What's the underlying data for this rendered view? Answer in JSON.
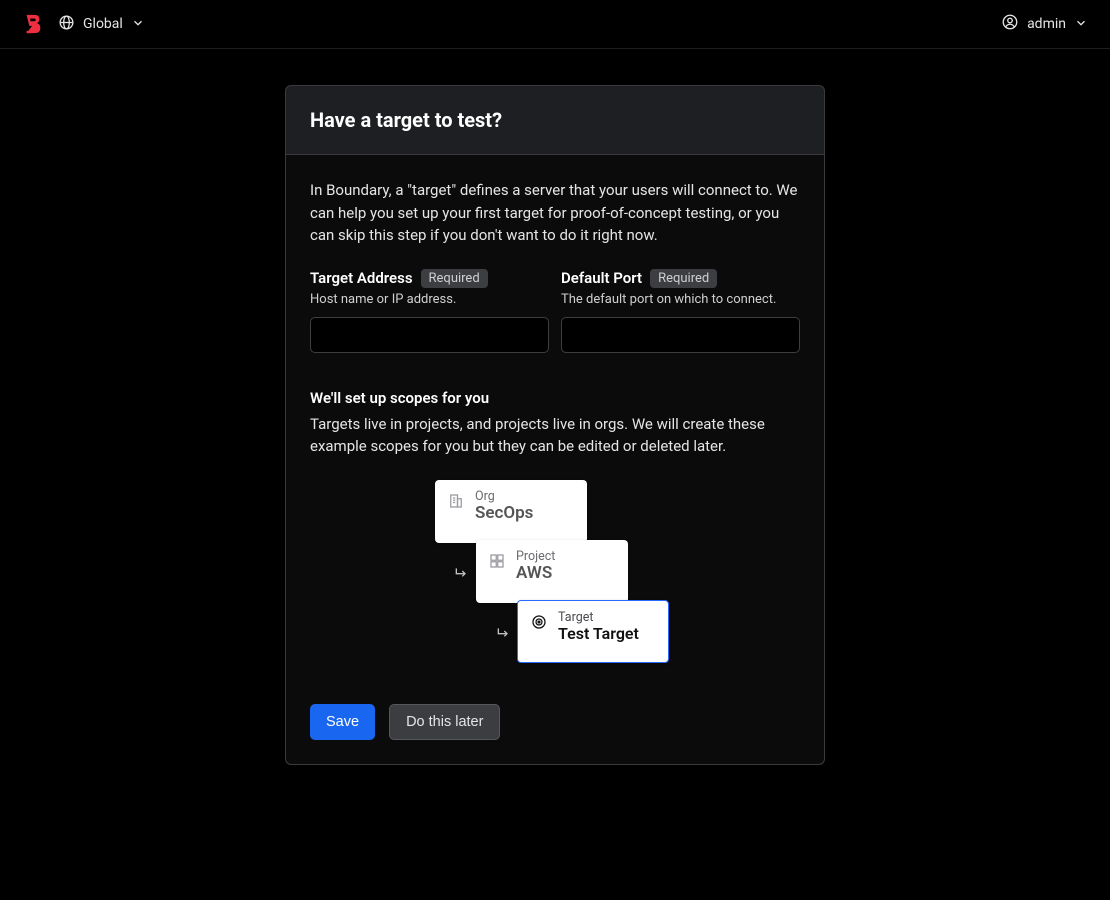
{
  "header": {
    "scope_label": "Global",
    "user_label": "admin"
  },
  "dialog": {
    "title": "Have a target to test?",
    "intro": "In Boundary, a \"target\" defines a server that your users will connect to. We can help you set up your first target for proof-of-concept testing, or you can skip this step if you don't want to do it right now.",
    "fields": {
      "address": {
        "label": "Target Address",
        "badge": "Required",
        "help": "Host name or IP address.",
        "value": ""
      },
      "port": {
        "label": "Default Port",
        "badge": "Required",
        "help": "The default port on which to connect.",
        "value": ""
      }
    },
    "scopes": {
      "title": "We'll set up scopes for you",
      "desc": "Targets live in projects, and projects live in orgs. We will create these example scopes for you but they can be edited or deleted later.",
      "cards": {
        "org_kicker": "Org",
        "org_name": "SecOps",
        "project_kicker": "Project",
        "project_name": "AWS",
        "target_kicker": "Target",
        "target_name": "Test Target"
      }
    },
    "buttons": {
      "save": "Save",
      "later": "Do this later"
    }
  }
}
